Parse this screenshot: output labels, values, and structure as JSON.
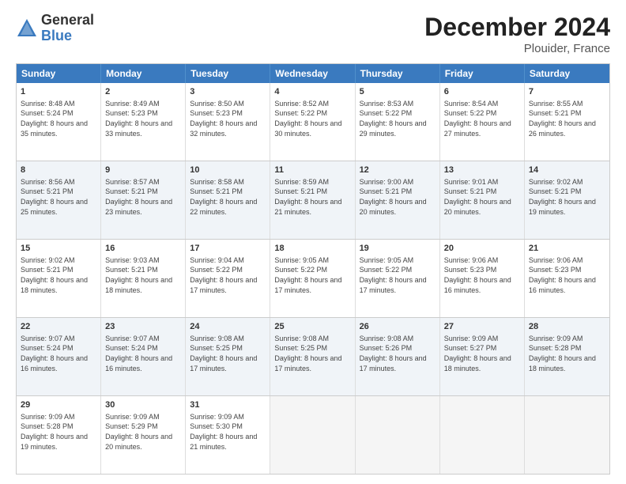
{
  "header": {
    "logo_general": "General",
    "logo_blue": "Blue",
    "title": "December 2024",
    "location": "Plouider, France"
  },
  "days_of_week": [
    "Sunday",
    "Monday",
    "Tuesday",
    "Wednesday",
    "Thursday",
    "Friday",
    "Saturday"
  ],
  "rows": [
    [
      {
        "day": "1",
        "sunrise": "Sunrise: 8:48 AM",
        "sunset": "Sunset: 5:24 PM",
        "daylight": "Daylight: 8 hours and 35 minutes."
      },
      {
        "day": "2",
        "sunrise": "Sunrise: 8:49 AM",
        "sunset": "Sunset: 5:23 PM",
        "daylight": "Daylight: 8 hours and 33 minutes."
      },
      {
        "day": "3",
        "sunrise": "Sunrise: 8:50 AM",
        "sunset": "Sunset: 5:23 PM",
        "daylight": "Daylight: 8 hours and 32 minutes."
      },
      {
        "day": "4",
        "sunrise": "Sunrise: 8:52 AM",
        "sunset": "Sunset: 5:22 PM",
        "daylight": "Daylight: 8 hours and 30 minutes."
      },
      {
        "day": "5",
        "sunrise": "Sunrise: 8:53 AM",
        "sunset": "Sunset: 5:22 PM",
        "daylight": "Daylight: 8 hours and 29 minutes."
      },
      {
        "day": "6",
        "sunrise": "Sunrise: 8:54 AM",
        "sunset": "Sunset: 5:22 PM",
        "daylight": "Daylight: 8 hours and 27 minutes."
      },
      {
        "day": "7",
        "sunrise": "Sunrise: 8:55 AM",
        "sunset": "Sunset: 5:21 PM",
        "daylight": "Daylight: 8 hours and 26 minutes."
      }
    ],
    [
      {
        "day": "8",
        "sunrise": "Sunrise: 8:56 AM",
        "sunset": "Sunset: 5:21 PM",
        "daylight": "Daylight: 8 hours and 25 minutes."
      },
      {
        "day": "9",
        "sunrise": "Sunrise: 8:57 AM",
        "sunset": "Sunset: 5:21 PM",
        "daylight": "Daylight: 8 hours and 23 minutes."
      },
      {
        "day": "10",
        "sunrise": "Sunrise: 8:58 AM",
        "sunset": "Sunset: 5:21 PM",
        "daylight": "Daylight: 8 hours and 22 minutes."
      },
      {
        "day": "11",
        "sunrise": "Sunrise: 8:59 AM",
        "sunset": "Sunset: 5:21 PM",
        "daylight": "Daylight: 8 hours and 21 minutes."
      },
      {
        "day": "12",
        "sunrise": "Sunrise: 9:00 AM",
        "sunset": "Sunset: 5:21 PM",
        "daylight": "Daylight: 8 hours and 20 minutes."
      },
      {
        "day": "13",
        "sunrise": "Sunrise: 9:01 AM",
        "sunset": "Sunset: 5:21 PM",
        "daylight": "Daylight: 8 hours and 20 minutes."
      },
      {
        "day": "14",
        "sunrise": "Sunrise: 9:02 AM",
        "sunset": "Sunset: 5:21 PM",
        "daylight": "Daylight: 8 hours and 19 minutes."
      }
    ],
    [
      {
        "day": "15",
        "sunrise": "Sunrise: 9:02 AM",
        "sunset": "Sunset: 5:21 PM",
        "daylight": "Daylight: 8 hours and 18 minutes."
      },
      {
        "day": "16",
        "sunrise": "Sunrise: 9:03 AM",
        "sunset": "Sunset: 5:21 PM",
        "daylight": "Daylight: 8 hours and 18 minutes."
      },
      {
        "day": "17",
        "sunrise": "Sunrise: 9:04 AM",
        "sunset": "Sunset: 5:22 PM",
        "daylight": "Daylight: 8 hours and 17 minutes."
      },
      {
        "day": "18",
        "sunrise": "Sunrise: 9:05 AM",
        "sunset": "Sunset: 5:22 PM",
        "daylight": "Daylight: 8 hours and 17 minutes."
      },
      {
        "day": "19",
        "sunrise": "Sunrise: 9:05 AM",
        "sunset": "Sunset: 5:22 PM",
        "daylight": "Daylight: 8 hours and 17 minutes."
      },
      {
        "day": "20",
        "sunrise": "Sunrise: 9:06 AM",
        "sunset": "Sunset: 5:23 PM",
        "daylight": "Daylight: 8 hours and 16 minutes."
      },
      {
        "day": "21",
        "sunrise": "Sunrise: 9:06 AM",
        "sunset": "Sunset: 5:23 PM",
        "daylight": "Daylight: 8 hours and 16 minutes."
      }
    ],
    [
      {
        "day": "22",
        "sunrise": "Sunrise: 9:07 AM",
        "sunset": "Sunset: 5:24 PM",
        "daylight": "Daylight: 8 hours and 16 minutes."
      },
      {
        "day": "23",
        "sunrise": "Sunrise: 9:07 AM",
        "sunset": "Sunset: 5:24 PM",
        "daylight": "Daylight: 8 hours and 16 minutes."
      },
      {
        "day": "24",
        "sunrise": "Sunrise: 9:08 AM",
        "sunset": "Sunset: 5:25 PM",
        "daylight": "Daylight: 8 hours and 17 minutes."
      },
      {
        "day": "25",
        "sunrise": "Sunrise: 9:08 AM",
        "sunset": "Sunset: 5:25 PM",
        "daylight": "Daylight: 8 hours and 17 minutes."
      },
      {
        "day": "26",
        "sunrise": "Sunrise: 9:08 AM",
        "sunset": "Sunset: 5:26 PM",
        "daylight": "Daylight: 8 hours and 17 minutes."
      },
      {
        "day": "27",
        "sunrise": "Sunrise: 9:09 AM",
        "sunset": "Sunset: 5:27 PM",
        "daylight": "Daylight: 8 hours and 18 minutes."
      },
      {
        "day": "28",
        "sunrise": "Sunrise: 9:09 AM",
        "sunset": "Sunset: 5:28 PM",
        "daylight": "Daylight: 8 hours and 18 minutes."
      }
    ],
    [
      {
        "day": "29",
        "sunrise": "Sunrise: 9:09 AM",
        "sunset": "Sunset: 5:28 PM",
        "daylight": "Daylight: 8 hours and 19 minutes."
      },
      {
        "day": "30",
        "sunrise": "Sunrise: 9:09 AM",
        "sunset": "Sunset: 5:29 PM",
        "daylight": "Daylight: 8 hours and 20 minutes."
      },
      {
        "day": "31",
        "sunrise": "Sunrise: 9:09 AM",
        "sunset": "Sunset: 5:30 PM",
        "daylight": "Daylight: 8 hours and 21 minutes."
      },
      null,
      null,
      null,
      null
    ]
  ]
}
